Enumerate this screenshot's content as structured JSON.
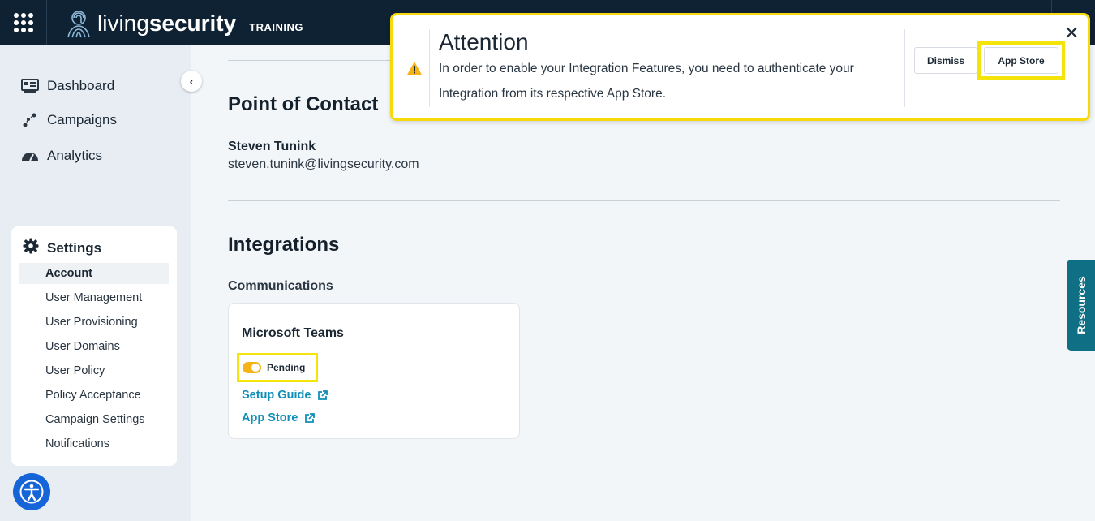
{
  "app": {
    "brand_light": "living",
    "brand_bold": "security",
    "badge": "TRAINING"
  },
  "sidebar": {
    "collapse_icon": "chevron-left-icon",
    "items": [
      {
        "label": "Dashboard",
        "icon": "dashboard-icon"
      },
      {
        "label": "Campaigns",
        "icon": "campaigns-icon"
      },
      {
        "label": "Analytics",
        "icon": "gauge-icon"
      }
    ],
    "settings": {
      "label": "Settings",
      "icon": "gear-icon",
      "subitems": [
        {
          "label": "Account",
          "active": true
        },
        {
          "label": "User Management"
        },
        {
          "label": "User Provisioning"
        },
        {
          "label": "User Domains"
        },
        {
          "label": "User Policy"
        },
        {
          "label": "Policy Acceptance"
        },
        {
          "label": "Campaign Settings"
        },
        {
          "label": "Notifications"
        }
      ]
    }
  },
  "main": {
    "point_of_contact": {
      "heading": "Point of Contact",
      "name": "Steven Tunink",
      "email": "steven.tunink@livingsecurity.com"
    },
    "integrations": {
      "heading": "Integrations",
      "category": "Communications",
      "card": {
        "title": "Microsoft Teams",
        "status": "Pending",
        "setup_guide": "Setup Guide",
        "app_store": "App Store"
      }
    }
  },
  "resources_tab": "Resources",
  "attention": {
    "title": "Attention",
    "message": "In order to enable your Integration Features, you need to authenticate your Integration from its respective App Store.",
    "dismiss": "Dismiss",
    "app_store": "App Store",
    "close_icon": "close-icon"
  },
  "colors": {
    "topbar": "#0f2233",
    "highlight": "#f5e40a",
    "link": "#0f8fb8",
    "pending": "#f5b318",
    "accessibility": "#1565d8"
  }
}
